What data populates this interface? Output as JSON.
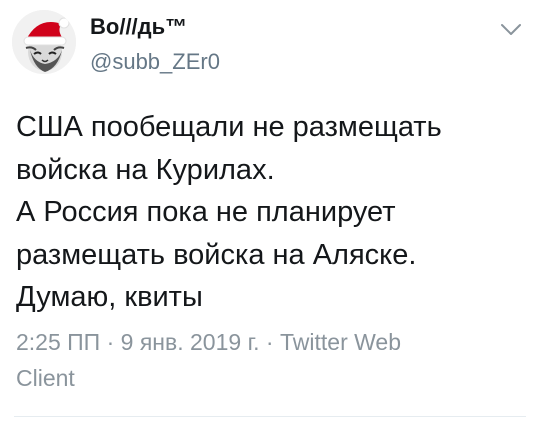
{
  "user": {
    "display_name": "Во///дь™",
    "handle": "@subb_ZEr0",
    "avatar_icon": "avatar-santa-hat-icon"
  },
  "menu": {
    "icon": "chevron-down-icon"
  },
  "tweet": {
    "lines": [
      "США пообещали не размещать",
      "войска на Курилах.",
      "А Россия пока не планирует",
      "размещать войска на Аляске.",
      "Думаю, квиты"
    ]
  },
  "meta": {
    "time": "2:25 ПП",
    "separator1": " · ",
    "date": "9 янв. 2019 г.",
    "separator2": " · ",
    "source_part1": "Twitter Web",
    "source_part2": "Client"
  },
  "colors": {
    "text": "#14171a",
    "secondary": "#657786",
    "meta": "#8a949c",
    "divider": "#e6ecf0",
    "hat_red": "#d0021b"
  }
}
